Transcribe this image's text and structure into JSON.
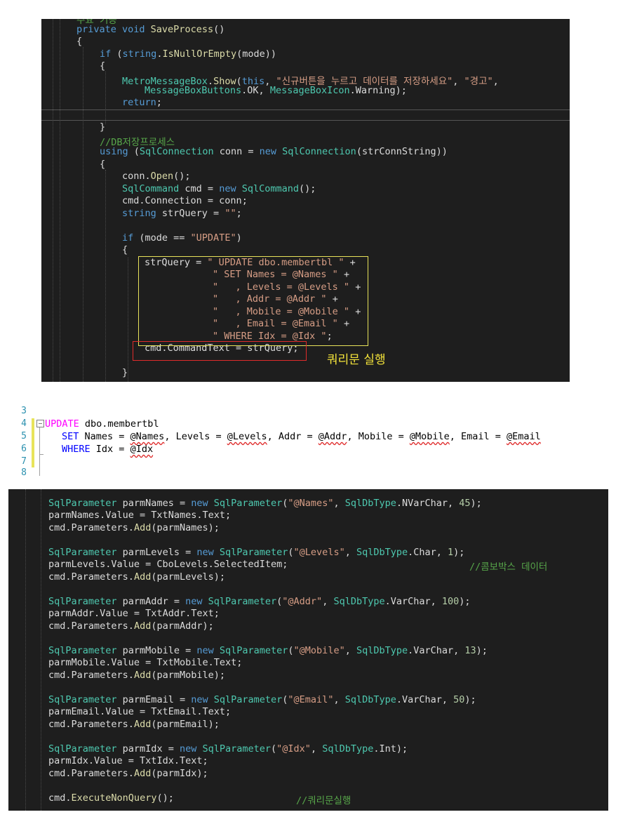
{
  "panel1": {
    "lines": [
      {
        "text": "주요 기능",
        "cls": "cm"
      },
      {
        "segs": [
          [
            "private ",
            "kw"
          ],
          [
            "void ",
            "kw"
          ],
          [
            "SaveProcess",
            "fn"
          ],
          [
            "()",
            "pl"
          ]
        ]
      },
      {
        "segs": [
          [
            "{",
            "pl"
          ]
        ]
      },
      {
        "segs": [
          [
            "if ",
            "kw"
          ],
          [
            "(",
            "pl"
          ],
          [
            "string",
            "kw"
          ],
          [
            ".",
            "pl"
          ],
          [
            "IsNullOrEmpty",
            "fn"
          ],
          [
            "(mode))",
            "pl"
          ]
        ]
      },
      {
        "segs": [
          [
            "{",
            "pl"
          ]
        ]
      },
      {
        "segs": [
          [
            "MetroMessageBox",
            "ty"
          ],
          [
            ".",
            "pl"
          ],
          [
            "Show",
            "fn"
          ],
          [
            "(",
            "pl"
          ],
          [
            "this",
            "kw"
          ],
          [
            ", ",
            "pl"
          ],
          [
            "\"신규버튼을 누르고 데이터를 저장하세요\"",
            "st"
          ],
          [
            ", ",
            "pl"
          ],
          [
            "\"경고\"",
            "st"
          ],
          [
            ",",
            "pl"
          ]
        ]
      },
      {
        "segs": [
          [
            "MessageBoxButtons",
            "ty"
          ],
          [
            ".OK, ",
            "pl"
          ],
          [
            "MessageBoxIcon",
            "ty"
          ],
          [
            ".Warning);",
            "pl"
          ]
        ]
      },
      {
        "segs": [
          [
            "return",
            "kw"
          ],
          [
            ";",
            "pl"
          ]
        ]
      },
      {
        "segs": [
          [
            "}",
            "pl"
          ]
        ]
      },
      {
        "segs": [
          [
            "//DB저장프로세스",
            "cm"
          ]
        ]
      },
      {
        "segs": [
          [
            "using ",
            "kw"
          ],
          [
            "(",
            "pl"
          ],
          [
            "SqlConnection ",
            "ty"
          ],
          [
            "conn = ",
            "pl"
          ],
          [
            "new ",
            "kw"
          ],
          [
            "SqlConnection",
            "ty"
          ],
          [
            "(strConnString))",
            "pl"
          ]
        ]
      },
      {
        "segs": [
          [
            "{",
            "pl"
          ]
        ]
      },
      {
        "segs": [
          [
            "conn",
            "pl"
          ],
          [
            ".",
            "pl"
          ],
          [
            "Open",
            "fn"
          ],
          [
            "();",
            "pl"
          ]
        ]
      },
      {
        "segs": [
          [
            "SqlCommand ",
            "ty"
          ],
          [
            "cmd = ",
            "pl"
          ],
          [
            "new ",
            "kw"
          ],
          [
            "SqlCommand",
            "ty"
          ],
          [
            "();",
            "pl"
          ]
        ]
      },
      {
        "segs": [
          [
            "cmd",
            "pl"
          ],
          [
            ".Connection = conn;",
            "pl"
          ]
        ]
      },
      {
        "segs": [
          [
            "string ",
            "kw"
          ],
          [
            "strQuery = ",
            "pl"
          ],
          [
            "\"\"",
            "st"
          ],
          [
            ";",
            "pl"
          ]
        ]
      },
      {
        "segs": [
          [
            "if ",
            "kw"
          ],
          [
            "(mode == ",
            "pl"
          ],
          [
            "\"UPDATE\"",
            "st"
          ],
          [
            ")",
            "pl"
          ]
        ]
      },
      {
        "segs": [
          [
            "{",
            "pl"
          ]
        ]
      },
      {
        "segs": [
          [
            "strQuery = ",
            "pl"
          ],
          [
            "\" UPDATE dbo.membertbl \"",
            "st"
          ],
          [
            " +",
            "pl"
          ]
        ]
      },
      {
        "segs": [
          [
            "\" SET Names = @Names \"",
            "st"
          ],
          [
            " +",
            "pl"
          ]
        ]
      },
      {
        "segs": [
          [
            "\"   , Levels = @Levels \"",
            "st"
          ],
          [
            " +",
            "pl"
          ]
        ]
      },
      {
        "segs": [
          [
            "\"   , Addr = @Addr \"",
            "st"
          ],
          [
            " +",
            "pl"
          ]
        ]
      },
      {
        "segs": [
          [
            "\"   , Mobile = @Mobile \"",
            "st"
          ],
          [
            " +",
            "pl"
          ]
        ]
      },
      {
        "segs": [
          [
            "\"   , Email = @Email \"",
            "st"
          ],
          [
            " +",
            "pl"
          ]
        ]
      },
      {
        "segs": [
          [
            "\" WHERE Idx = @Idx \"",
            "st"
          ],
          [
            ";",
            "pl"
          ]
        ]
      },
      {
        "segs": [
          [
            "cmd",
            "pl"
          ],
          [
            ".CommandText = strQuery;",
            "pl"
          ]
        ]
      },
      {
        "segs": [
          [
            "}",
            "pl"
          ]
        ]
      }
    ],
    "annotation": "쿼리문 실행"
  },
  "panel2": {
    "line_numbers": [
      "3",
      "4",
      "5",
      "6",
      "7",
      "8"
    ],
    "lines": [
      {
        "segs": [
          [
            "UPDATE ",
            "l-kw2"
          ],
          [
            "dbo.membertbl",
            "l-pl"
          ]
        ]
      },
      {
        "segs": [
          [
            "SET ",
            "l-kw"
          ],
          [
            "Names = ",
            "l-pl"
          ],
          [
            "@Names",
            "l-var"
          ],
          [
            ", Levels = ",
            "l-pl"
          ],
          [
            "@Levels",
            "l-var"
          ],
          [
            ", Addr = ",
            "l-pl"
          ],
          [
            "@Addr",
            "l-var"
          ],
          [
            ", Mobile = ",
            "l-pl"
          ],
          [
            "@Mobile",
            "l-var"
          ],
          [
            ", Email = ",
            "l-pl"
          ],
          [
            "@Email",
            "l-var"
          ]
        ]
      },
      {
        "segs": [
          [
            "WHERE ",
            "l-kw"
          ],
          [
            "Idx = ",
            "l-pl"
          ],
          [
            "@Idx",
            "l-var"
          ]
        ]
      }
    ]
  },
  "panel3": {
    "lines": [
      {
        "segs": [
          [
            "SqlParameter ",
            "ty"
          ],
          [
            "parmNames = ",
            "pl"
          ],
          [
            "new ",
            "kw"
          ],
          [
            "SqlParameter",
            "ty"
          ],
          [
            "(",
            "pl"
          ],
          [
            "\"@Names\"",
            "st"
          ],
          [
            ", ",
            "pl"
          ],
          [
            "SqlDbType",
            "ty"
          ],
          [
            ".NVarChar, ",
            "pl"
          ],
          [
            "45",
            "nu"
          ],
          [
            ");",
            "pl"
          ]
        ]
      },
      {
        "segs": [
          [
            "parmNames",
            "pl"
          ],
          [
            ".Value = TxtNames.Text;",
            "pl"
          ]
        ]
      },
      {
        "segs": [
          [
            "cmd",
            "pl"
          ],
          [
            ".Parameters.",
            "pl"
          ],
          [
            "Add",
            "fn"
          ],
          [
            "(parmNames);",
            "pl"
          ]
        ]
      },
      {
        "segs": [
          [
            "SqlParameter ",
            "ty"
          ],
          [
            "parmLevels = ",
            "pl"
          ],
          [
            "new ",
            "kw"
          ],
          [
            "SqlParameter",
            "ty"
          ],
          [
            "(",
            "pl"
          ],
          [
            "\"@Levels\"",
            "st"
          ],
          [
            ", ",
            "pl"
          ],
          [
            "SqlDbType",
            "ty"
          ],
          [
            ".Char, ",
            "pl"
          ],
          [
            "1",
            "nu"
          ],
          [
            ");",
            "pl"
          ]
        ]
      },
      {
        "segs": [
          [
            "parmLevels",
            "pl"
          ],
          [
            ".Value = CboLevels.SelectedItem;",
            "pl"
          ]
        ],
        "comment": "//콤보박스 데이터"
      },
      {
        "segs": [
          [
            "cmd",
            "pl"
          ],
          [
            ".Parameters.",
            "pl"
          ],
          [
            "Add",
            "fn"
          ],
          [
            "(parmLevels);",
            "pl"
          ]
        ]
      },
      {
        "segs": [
          [
            "SqlParameter ",
            "ty"
          ],
          [
            "parmAddr = ",
            "pl"
          ],
          [
            "new ",
            "kw"
          ],
          [
            "SqlParameter",
            "ty"
          ],
          [
            "(",
            "pl"
          ],
          [
            "\"@Addr\"",
            "st"
          ],
          [
            ", ",
            "pl"
          ],
          [
            "SqlDbType",
            "ty"
          ],
          [
            ".VarChar, ",
            "pl"
          ],
          [
            "100",
            "nu"
          ],
          [
            ");",
            "pl"
          ]
        ]
      },
      {
        "segs": [
          [
            "parmAddr",
            "pl"
          ],
          [
            ".Value = TxtAddr.Text;",
            "pl"
          ]
        ]
      },
      {
        "segs": [
          [
            "cmd",
            "pl"
          ],
          [
            ".Parameters.",
            "pl"
          ],
          [
            "Add",
            "fn"
          ],
          [
            "(parmAddr);",
            "pl"
          ]
        ]
      },
      {
        "segs": [
          [
            "SqlParameter ",
            "ty"
          ],
          [
            "parmMobile = ",
            "pl"
          ],
          [
            "new ",
            "kw"
          ],
          [
            "SqlParameter",
            "ty"
          ],
          [
            "(",
            "pl"
          ],
          [
            "\"@Mobile\"",
            "st"
          ],
          [
            ", ",
            "pl"
          ],
          [
            "SqlDbType",
            "ty"
          ],
          [
            ".VarChar, ",
            "pl"
          ],
          [
            "13",
            "nu"
          ],
          [
            ");",
            "pl"
          ]
        ]
      },
      {
        "segs": [
          [
            "parmMobile",
            "pl"
          ],
          [
            ".Value = TxtMobile.Text;",
            "pl"
          ]
        ]
      },
      {
        "segs": [
          [
            "cmd",
            "pl"
          ],
          [
            ".Parameters.",
            "pl"
          ],
          [
            "Add",
            "fn"
          ],
          [
            "(parmMobile);",
            "pl"
          ]
        ]
      },
      {
        "segs": [
          [
            "SqlParameter ",
            "ty"
          ],
          [
            "parmEmail = ",
            "pl"
          ],
          [
            "new ",
            "kw"
          ],
          [
            "SqlParameter",
            "ty"
          ],
          [
            "(",
            "pl"
          ],
          [
            "\"@Email\"",
            "st"
          ],
          [
            ", ",
            "pl"
          ],
          [
            "SqlDbType",
            "ty"
          ],
          [
            ".VarChar, ",
            "pl"
          ],
          [
            "50",
            "nu"
          ],
          [
            ");",
            "pl"
          ]
        ]
      },
      {
        "segs": [
          [
            "parmEmail",
            "pl"
          ],
          [
            ".Value = TxtEmail.Text;",
            "pl"
          ]
        ]
      },
      {
        "segs": [
          [
            "cmd",
            "pl"
          ],
          [
            ".Parameters.",
            "pl"
          ],
          [
            "Add",
            "fn"
          ],
          [
            "(parmEmail);",
            "pl"
          ]
        ]
      },
      {
        "segs": [
          [
            "SqlParameter ",
            "ty"
          ],
          [
            "parmIdx = ",
            "pl"
          ],
          [
            "new ",
            "kw"
          ],
          [
            "SqlParameter",
            "ty"
          ],
          [
            "(",
            "pl"
          ],
          [
            "\"@Idx\"",
            "st"
          ],
          [
            ", ",
            "pl"
          ],
          [
            "SqlDbType",
            "ty"
          ],
          [
            ".Int);",
            "pl"
          ]
        ]
      },
      {
        "segs": [
          [
            "parmIdx",
            "pl"
          ],
          [
            ".Value = TxtIdx.Text;",
            "pl"
          ]
        ]
      },
      {
        "segs": [
          [
            "cmd",
            "pl"
          ],
          [
            ".Parameters.",
            "pl"
          ],
          [
            "Add",
            "fn"
          ],
          [
            "(parmIdx);",
            "pl"
          ]
        ]
      },
      {
        "segs": [
          [
            "cmd",
            "pl"
          ],
          [
            ".",
            "pl"
          ],
          [
            "ExecuteNonQuery",
            "fn"
          ],
          [
            "();",
            "pl"
          ]
        ],
        "comment": "//쿼리문실행"
      }
    ]
  }
}
